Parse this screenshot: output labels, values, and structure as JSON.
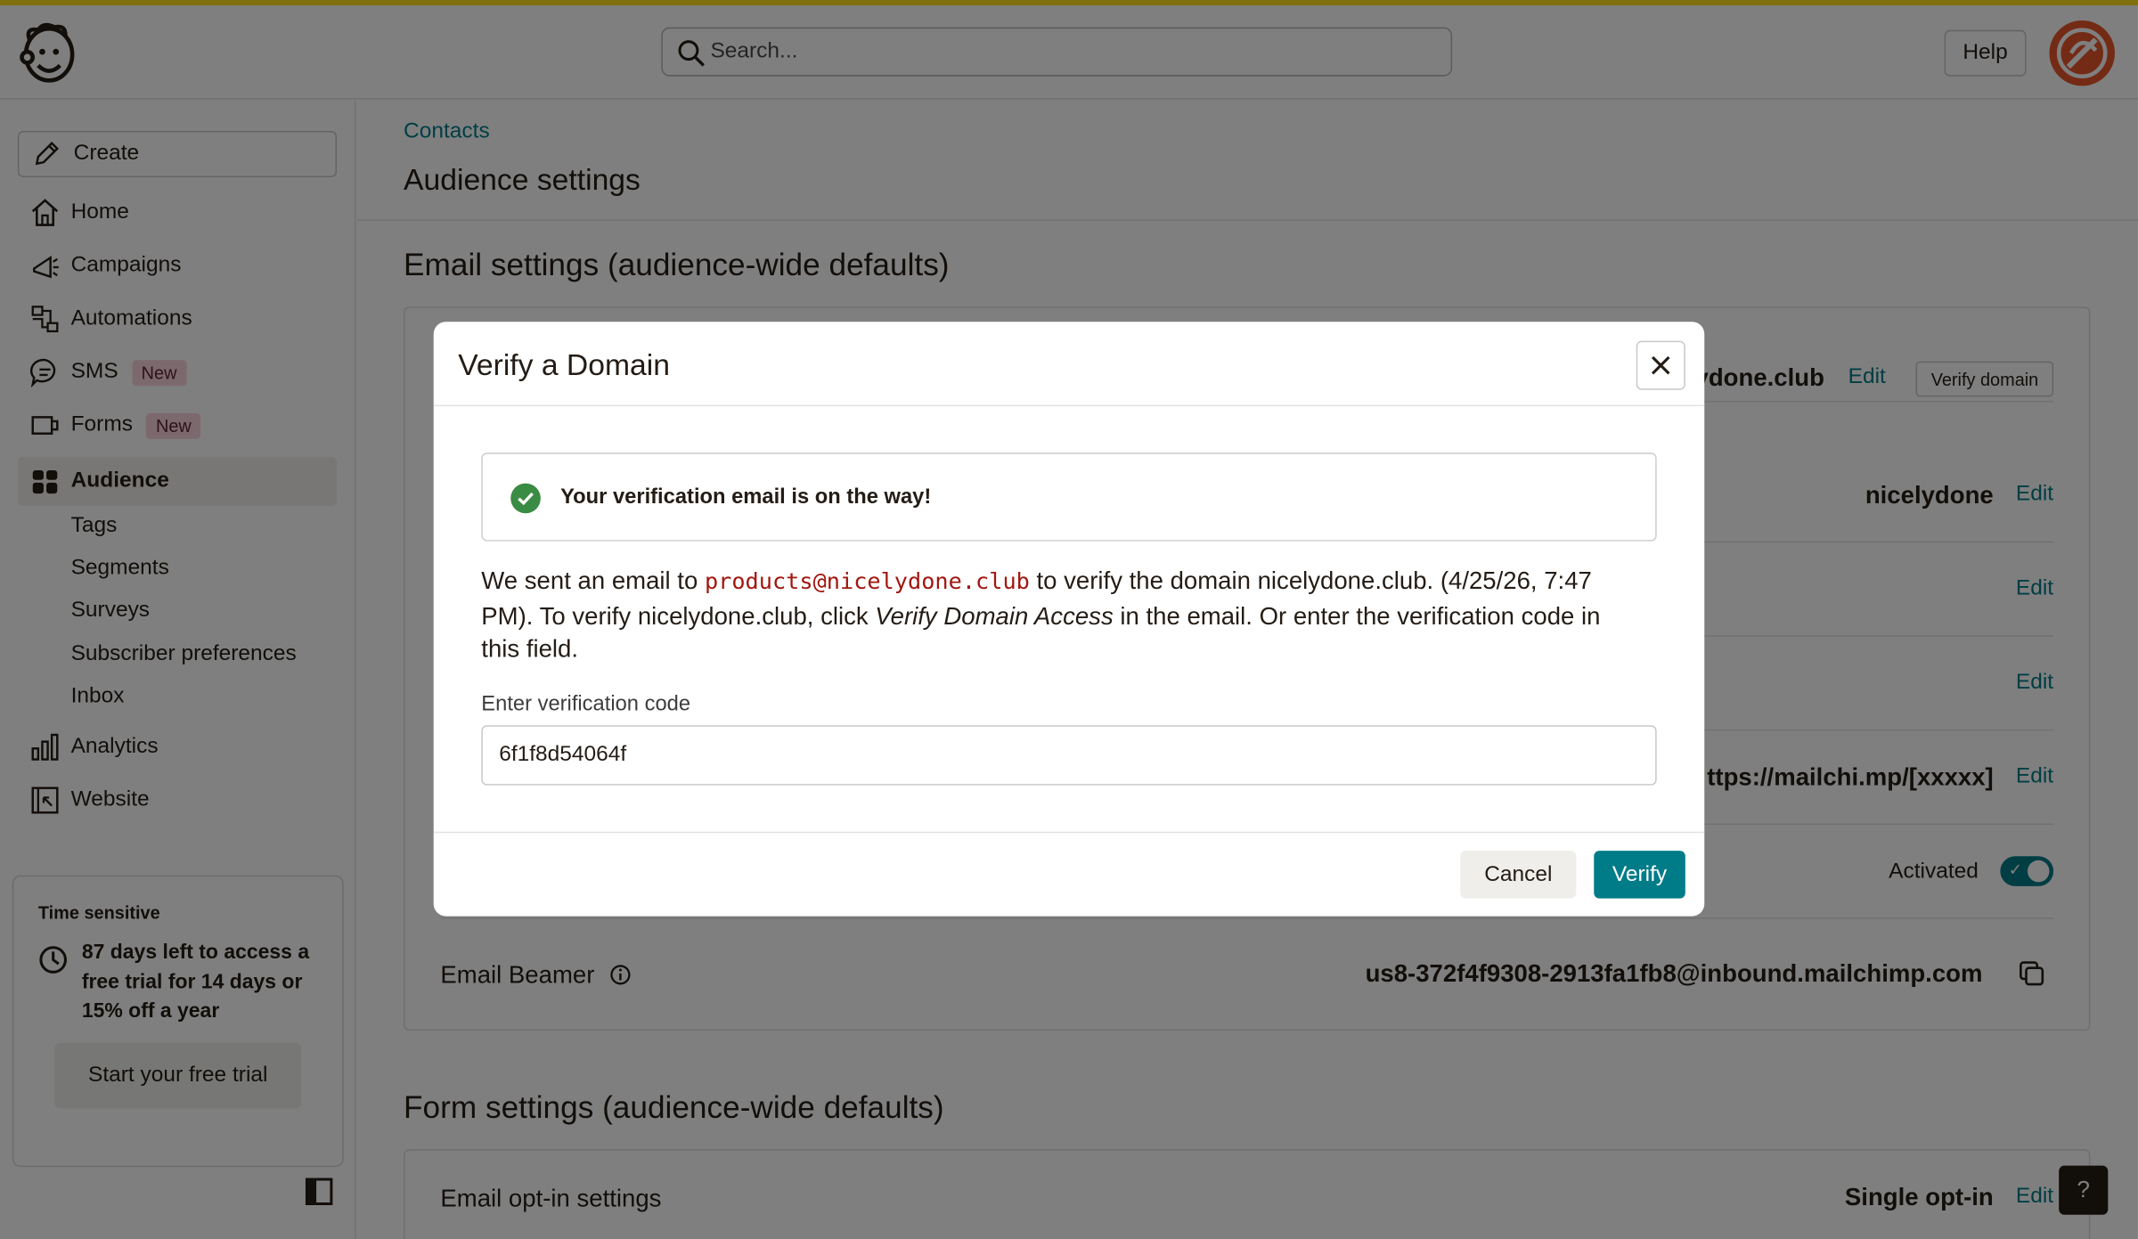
{
  "colors": {
    "accent": "#007c89",
    "brand_yellow": "#ffe01b",
    "badge_bg": "#f8d2dc",
    "mono_red": "#a1170f"
  },
  "header": {
    "search_placeholder": "Search...",
    "help_label": "Help"
  },
  "sidebar": {
    "create_label": "Create",
    "items": [
      {
        "label": "Home",
        "icon": "home-icon"
      },
      {
        "label": "Campaigns",
        "icon": "megaphone-icon"
      },
      {
        "label": "Automations",
        "icon": "automations-icon"
      },
      {
        "label": "SMS",
        "icon": "sms-icon",
        "badge": "New"
      },
      {
        "label": "Forms",
        "icon": "forms-icon",
        "badge": "New"
      },
      {
        "label": "Audience",
        "icon": "audience-icon",
        "active": true
      }
    ],
    "sub_items": [
      "Tags",
      "Segments",
      "Surveys",
      "Subscriber preferences",
      "Inbox"
    ],
    "lower_items": [
      {
        "label": "Analytics",
        "icon": "analytics-icon"
      },
      {
        "label": "Website",
        "icon": "website-icon"
      }
    ],
    "trial": {
      "heading": "Time sensitive",
      "message": "87 days left to access a free trial for 14 days or 15% off a year",
      "button": "Start your free trial"
    }
  },
  "main": {
    "breadcrumb": "Contacts",
    "page_title": "Audience settings",
    "email_section_title": "Email settings (audience-wide defaults)",
    "email_rows": [
      {
        "value": "ydone.club",
        "edit": "Edit",
        "extra_button": "Verify domain"
      },
      {
        "value": "nicelydone",
        "edit": "Edit"
      },
      {
        "value": "",
        "edit": "Edit"
      },
      {
        "value": "",
        "edit": "Edit"
      },
      {
        "value": "ttps://mailchi.mp/[xxxxx]",
        "edit": "Edit"
      },
      {
        "value": "Activated",
        "toggle": true
      }
    ],
    "email_beamer": {
      "label": "Email Beamer",
      "address": "us8-372f4f9308-2913fa1fb8@inbound.mailchimp.com"
    },
    "form_section_title": "Form settings (audience-wide defaults)",
    "form_rows": [
      {
        "label": "Email opt-in settings",
        "value": "Single opt-in",
        "edit": "Edit"
      }
    ],
    "help_fab": "?"
  },
  "modal": {
    "title": "Verify a Domain",
    "alert": "Your verification email is on the way!",
    "text_pre": "We sent an email to ",
    "email": "products@nicelydone.club",
    "text_mid": " to verify the domain nicelydone.club. (4/25/26, 7:47 PM). To verify nicelydone.club, click ",
    "emph": "Verify Domain Access",
    "text_post": " in the email. Or enter the verification code in this field.",
    "field_label": "Enter verification code",
    "code_value": "6f1f8d54064f",
    "cancel_label": "Cancel",
    "verify_label": "Verify"
  }
}
